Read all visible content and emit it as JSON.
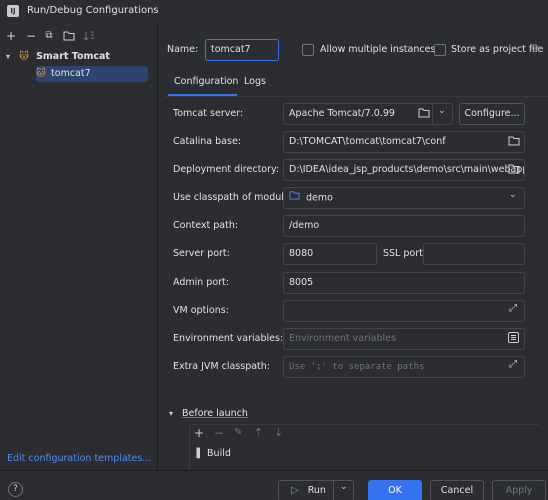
{
  "window": {
    "title": "Run/Debug Configurations"
  },
  "toolbar": {
    "add": "+",
    "remove": "−",
    "copy": "⧉",
    "folder": "🗀",
    "sort": "↓ª"
  },
  "tree": {
    "group_label": "Smart Tomcat",
    "item_label": "tomcat7"
  },
  "templates_link": "Edit configuration templates...",
  "name": {
    "label": "Name:",
    "value": "tomcat7",
    "allow_multiple_label": "Allow multiple instances",
    "store_label": "Store as project file"
  },
  "tabs": [
    {
      "label": "Configuration"
    },
    {
      "label": "Logs"
    }
  ],
  "form": {
    "tomcat_server_label": "Tomcat server:",
    "tomcat_server_value": "Apache Tomcat/7.0.99",
    "configure_label": "Configure...",
    "catalina_base_label": "Catalina base:",
    "catalina_base_value": "D:\\TOMCAT\\tomcat\\tomcat7\\conf",
    "deployment_dir_label": "Deployment directory:",
    "deployment_dir_value": "D:\\IDEA\\idea_jsp_products\\demo\\src\\main\\webapp",
    "classpath_module_label": "Use classpath of module:",
    "classpath_module_value": "demo",
    "context_path_label": "Context path:",
    "context_path_value": "/demo",
    "server_port_label": "Server port:",
    "server_port_value": "8080",
    "ssl_port_label": "SSL port:",
    "ssl_port_value": "",
    "admin_port_label": "Admin port:",
    "admin_port_value": "8005",
    "vm_options_label": "VM options:",
    "vm_options_value": "",
    "env_vars_label": "Environment variables:",
    "env_vars_placeholder": "Environment variables",
    "extra_jvm_label": "Extra JVM classpath:",
    "extra_jvm_placeholder": "Use ';' to separate paths"
  },
  "before_launch": {
    "label": "Before launch",
    "task": "Build"
  },
  "buttons": {
    "help": "?",
    "run": "Run",
    "ok": "OK",
    "cancel": "Cancel",
    "apply": "Apply"
  }
}
